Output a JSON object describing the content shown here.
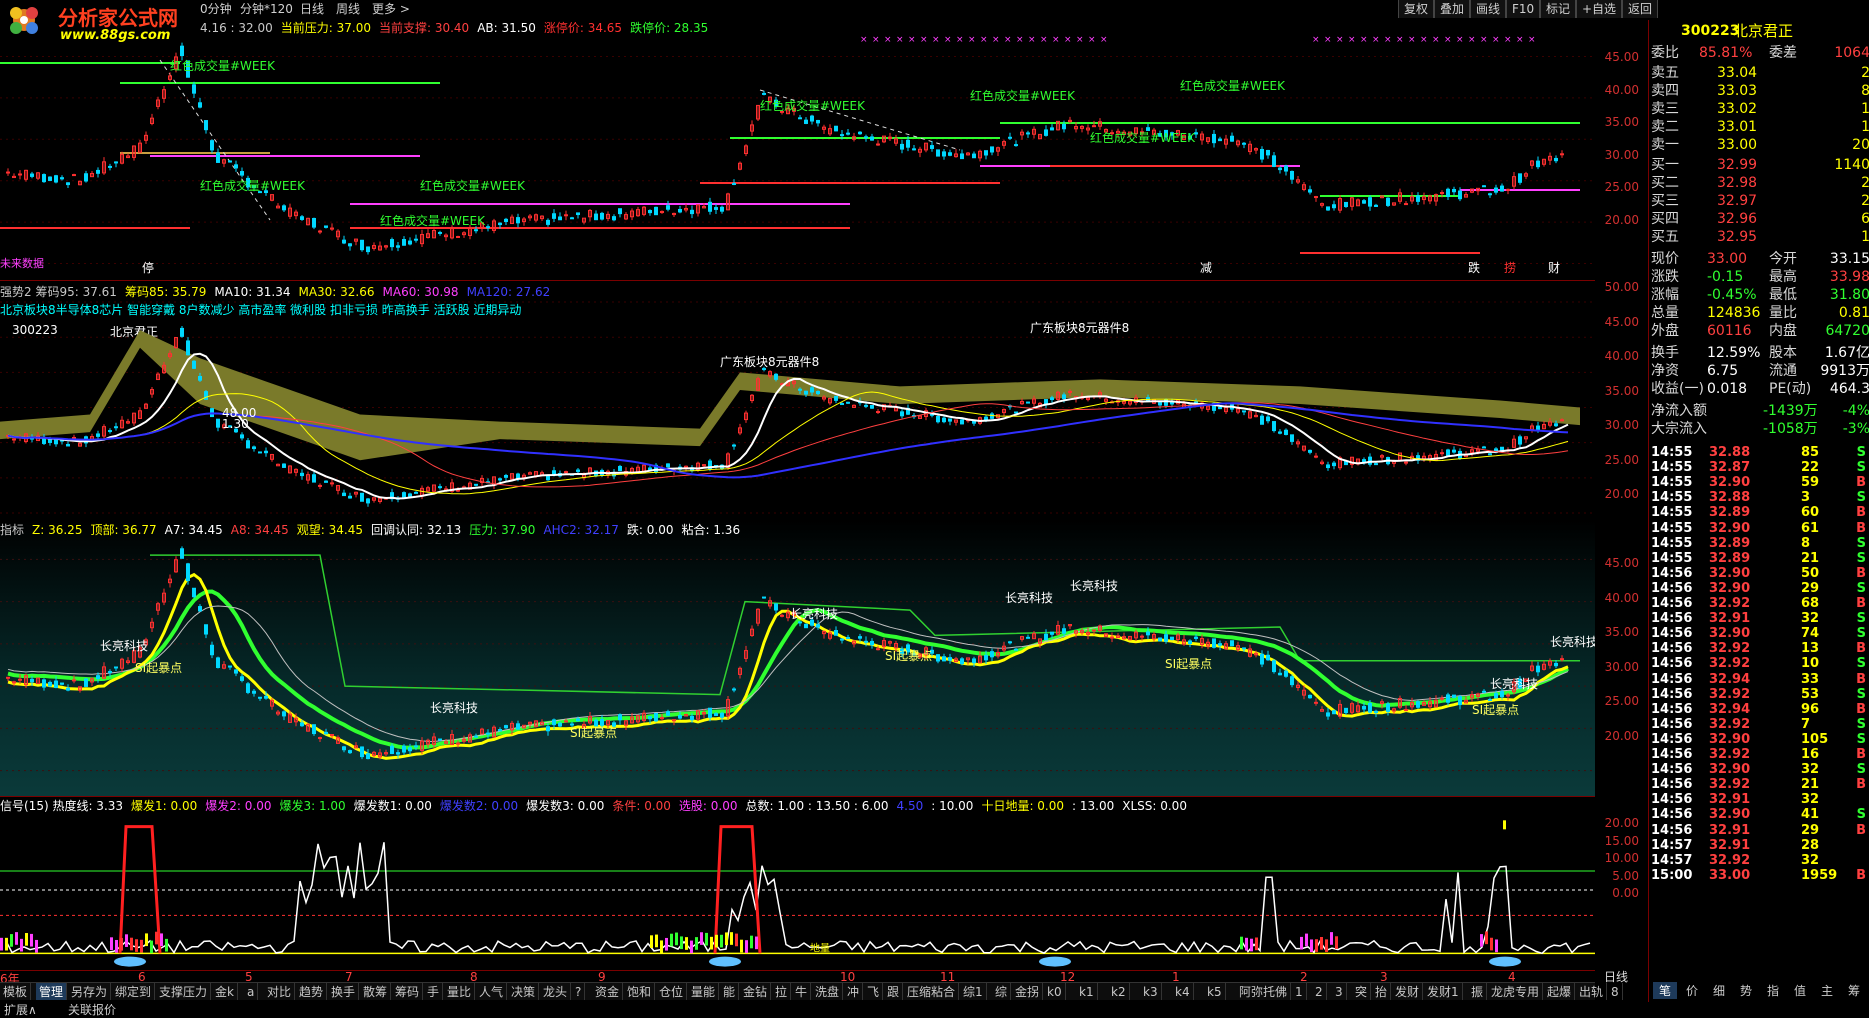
{
  "logo": {
    "title": "分析家公式网",
    "url": "www.88gs.com"
  },
  "topbar": {
    "left_items": [
      "0分钟",
      "分钟*120",
      "日线",
      "周线",
      "更多 >"
    ],
    "right_items": [
      "复权",
      "叠加",
      "画线",
      "F10",
      "标记",
      "+自选",
      "返回"
    ]
  },
  "stock": {
    "code": "300223",
    "name": "北京君正"
  },
  "panel1": {
    "header": [
      {
        "text": "4.16 : 32.00",
        "color": "#c8c8c8"
      },
      {
        "text": "当前压力: 37.00",
        "color": "#ffff00"
      },
      {
        "text": "当前支撑: 30.40",
        "color": "#ff4040"
      },
      {
        "text": "AB: 31.50",
        "color": "#ffffff"
      },
      {
        "text": "涨停价: 34.65",
        "color": "#ff3030"
      },
      {
        "text": "跌停价: 28.35",
        "color": "#30ff30"
      }
    ],
    "ticks": [
      "45.00",
      "40.00",
      "35.00",
      "30.00",
      "25.00",
      "20.00"
    ],
    "labels": [
      "红色成交量#WEEK",
      "红色成交量#WEEK",
      "红色成交量#WEEK",
      "红色成交量#WEEK",
      "红色成交量#WEEK",
      "红色成交量#WEEK",
      "红色成交量#WEEK",
      "红色成交量#WEEK"
    ],
    "events": [
      "停",
      "减",
      "跌",
      "捞",
      "财"
    ],
    "side_note": "未来数据"
  },
  "panel2": {
    "header1": [
      {
        "text": "强势2 筹码95: 37.61",
        "color": "#c8c8c8"
      },
      {
        "text": "筹码85: 35.79",
        "color": "#ffff00"
      },
      {
        "text": "MA10: 31.34",
        "color": "#ffffff"
      },
      {
        "text": "MA30: 32.66",
        "color": "#ffff00"
      },
      {
        "text": "MA60: 30.98",
        "color": "#ff40ff"
      },
      {
        "text": "MA120: 27.62",
        "color": "#4040ff"
      }
    ],
    "header2": "北京板块8半导体8芯片 智能穿戴 8户数减少 高市盈率 微利股 扣非亏损 昨高换手 活跃股 近期异动",
    "code_label": "300223",
    "name_label": "北京君正",
    "annotations": [
      "48.00",
      "1.30",
      "广东板块8元器件8",
      "广东板块8元器件8"
    ],
    "ticks": [
      "50.00",
      "45.00",
      "40.00",
      "35.00",
      "30.00",
      "25.00",
      "20.00"
    ]
  },
  "panel3": {
    "header": [
      {
        "text": "指标",
        "color": "#c8c8c8"
      },
      {
        "text": "Z: 36.25",
        "color": "#ffff00"
      },
      {
        "text": "顶部: 36.77",
        "color": "#ffff00"
      },
      {
        "text": "A7: 34.45",
        "color": "#ffffff"
      },
      {
        "text": "A8: 34.45",
        "color": "#ff4040"
      },
      {
        "text": "观望: 34.45",
        "color": "#ffff00"
      },
      {
        "text": "回调认同: 32.13",
        "color": "#ffffff"
      },
      {
        "text": "压力: 37.90",
        "color": "#30ff30"
      },
      {
        "text": "AHC2: 32.17",
        "color": "#4040ff"
      },
      {
        "text": "跌: 0.00",
        "color": "#ffffff"
      },
      {
        "text": "粘合: 1.36",
        "color": "#ffffff"
      }
    ],
    "labels": [
      "长亮科技",
      "SI起暴点",
      "长亮科技",
      "SI起暴点",
      "长亮科技",
      "SI起暴点",
      "长亮科技",
      "长亮科技",
      "SI起暴点",
      "长亮科技",
      "SI起暴点",
      "长亮科技"
    ],
    "ticks": [
      "45.00",
      "40.00",
      "35.00",
      "30.00",
      "25.00",
      "20.00"
    ]
  },
  "panel4": {
    "header": [
      {
        "text": "信号(15) 热度线: 3.33",
        "color": "#ffffff"
      },
      {
        "text": "爆发1: 0.00",
        "color": "#ffff00"
      },
      {
        "text": "爆发2: 0.00",
        "color": "#ff40ff"
      },
      {
        "text": "爆发3: 1.00",
        "color": "#30ff30"
      },
      {
        "text": "爆发数1: 0.00",
        "color": "#ffffff"
      },
      {
        "text": "爆发数2: 0.00",
        "color": "#4040ff"
      },
      {
        "text": "爆发数3: 0.00",
        "color": "#ffffff"
      },
      {
        "text": "条件: 0.00",
        "color": "#ff4040"
      },
      {
        "text": "选股: 0.00",
        "color": "#ff40ff"
      },
      {
        "text": "总数: 1.00 : 13.50 : 6.00",
        "color": "#ffffff"
      },
      {
        "text": "4.50",
        "color": "#4040ff"
      },
      {
        "text": ": 10.00",
        "color": "#ffffff"
      },
      {
        "text": "十日地量: 0.00",
        "color": "#ffff00"
      },
      {
        "text": ": 13.00",
        "color": "#ffffff"
      },
      {
        "text": "XLSS: 0.00",
        "color": "#ffffff"
      }
    ],
    "ticks": [
      "20.00",
      "15.00",
      "10.00",
      "5.00",
      "0.00"
    ],
    "marker_label": "地量"
  },
  "date_axis": [
    "6年",
    "6",
    "5",
    "7",
    "8",
    "9",
    "10",
    "11",
    "12",
    "1",
    "2",
    "3",
    "4"
  ],
  "date_axis_right": "日线",
  "bottom_tabs": [
    "管理",
    "另存为",
    "绑定到",
    "支撑压力",
    "金k",
    "a",
    "对比",
    "趋势",
    "换手",
    "散筹",
    "筹码",
    "手",
    "量比",
    "人气",
    "决策",
    "龙头",
    "?",
    "资金",
    "饱和",
    "仓位",
    "量能",
    "能",
    "金钻",
    "拉",
    "牛",
    "洗盘",
    "冲",
    "飞",
    "跟",
    "压缩粘合",
    "综1",
    "综",
    "金拐",
    "k0",
    "k1",
    "k2",
    "k3",
    "k4",
    "k5",
    "阿弥托佛",
    "1",
    "2",
    "3",
    "突",
    "抬",
    "发财",
    "发财1",
    "振",
    "龙虎专用",
    "起爆",
    "出轨",
    "8"
  ],
  "bottom_tab_first": "模板",
  "status_left": [
    "扩展∧",
    "关联报价"
  ],
  "quote": {
    "header_code": "300223",
    "header_name": "北京君正",
    "weibi_label": "委比",
    "weibi_value": "85.81%",
    "weicha_label": "委差",
    "weicha_value": "1064",
    "asks": [
      {
        "label": "卖五",
        "price": "33.04",
        "vol": "2"
      },
      {
        "label": "卖四",
        "price": "33.03",
        "vol": "8"
      },
      {
        "label": "卖三",
        "price": "33.02",
        "vol": "1"
      },
      {
        "label": "卖二",
        "price": "33.01",
        "vol": "1"
      },
      {
        "label": "卖一",
        "price": "33.00",
        "vol": "20"
      }
    ],
    "bids": [
      {
        "label": "买一",
        "price": "32.99",
        "vol": "1140"
      },
      {
        "label": "买二",
        "price": "32.98",
        "vol": "2"
      },
      {
        "label": "买三",
        "price": "32.97",
        "vol": "2"
      },
      {
        "label": "买四",
        "price": "32.96",
        "vol": "6"
      },
      {
        "label": "买五",
        "price": "32.95",
        "vol": "1"
      }
    ],
    "stats": [
      {
        "l1": "现价",
        "v1": "33.00",
        "c1": "#ff4040",
        "l2": "今开",
        "v2": "33.15",
        "c2": "#ffffff"
      },
      {
        "l1": "涨跌",
        "v1": "-0.15",
        "c1": "#30ff30",
        "l2": "最高",
        "v2": "33.98",
        "c2": "#ff4040"
      },
      {
        "l1": "涨幅",
        "v1": "-0.45%",
        "c1": "#30ff30",
        "l2": "最低",
        "v2": "31.80",
        "c2": "#30ff30"
      },
      {
        "l1": "总量",
        "v1": "124836",
        "c1": "#ffff00",
        "l2": "量比",
        "v2": "0.81",
        "c2": "#ffff00"
      },
      {
        "l1": "外盘",
        "v1": "60116",
        "c1": "#ff4040",
        "l2": "内盘",
        "v2": "64720",
        "c2": "#30ff30"
      }
    ],
    "stats2": [
      {
        "l1": "换手",
        "v1": "12.59%",
        "c1": "#ffffff",
        "l2": "股本",
        "v2": "1.67亿",
        "c2": "#ffffff"
      },
      {
        "l1": "净资",
        "v1": "6.75",
        "c1": "#ffffff",
        "l2": "流通",
        "v2": "9913万",
        "c2": "#ffffff"
      },
      {
        "l1": "收益(一)",
        "v1": "0.018",
        "c1": "#ffffff",
        "l2": "PE(动)",
        "v2": "464.3",
        "c2": "#ffffff"
      }
    ],
    "flow": [
      {
        "label": "净流入额",
        "v1": "-1439万",
        "v2": "-4%"
      },
      {
        "label": "大宗流入",
        "v1": "-1058万",
        "v2": "-3%"
      }
    ],
    "ticks": [
      {
        "t": "14:55",
        "p": "32.88",
        "v": "85",
        "d": "S"
      },
      {
        "t": "14:55",
        "p": "32.87",
        "v": "22",
        "d": "S"
      },
      {
        "t": "14:55",
        "p": "32.90",
        "v": "59",
        "d": "B"
      },
      {
        "t": "14:55",
        "p": "32.88",
        "v": "3",
        "d": "S"
      },
      {
        "t": "14:55",
        "p": "32.89",
        "v": "60",
        "d": "B"
      },
      {
        "t": "14:55",
        "p": "32.90",
        "v": "61",
        "d": "B"
      },
      {
        "t": "14:55",
        "p": "32.89",
        "v": "8",
        "d": "S"
      },
      {
        "t": "14:55",
        "p": "32.89",
        "v": "21",
        "d": "S"
      },
      {
        "t": "14:56",
        "p": "32.90",
        "v": "50",
        "d": "B"
      },
      {
        "t": "14:56",
        "p": "32.90",
        "v": "29",
        "d": "S"
      },
      {
        "t": "14:56",
        "p": "32.92",
        "v": "68",
        "d": "B"
      },
      {
        "t": "14:56",
        "p": "32.91",
        "v": "32",
        "d": "S"
      },
      {
        "t": "14:56",
        "p": "32.90",
        "v": "74",
        "d": "S"
      },
      {
        "t": "14:56",
        "p": "32.92",
        "v": "13",
        "d": "B"
      },
      {
        "t": "14:56",
        "p": "32.92",
        "v": "10",
        "d": "S"
      },
      {
        "t": "14:56",
        "p": "32.94",
        "v": "33",
        "d": "B"
      },
      {
        "t": "14:56",
        "p": "32.92",
        "v": "53",
        "d": "S"
      },
      {
        "t": "14:56",
        "p": "32.94",
        "v": "96",
        "d": "B"
      },
      {
        "t": "14:56",
        "p": "32.92",
        "v": "7",
        "d": "S"
      },
      {
        "t": "14:56",
        "p": "32.90",
        "v": "105",
        "d": "S"
      },
      {
        "t": "14:56",
        "p": "32.92",
        "v": "16",
        "d": "B"
      },
      {
        "t": "14:56",
        "p": "32.90",
        "v": "32",
        "d": "S"
      },
      {
        "t": "14:56",
        "p": "32.92",
        "v": "21",
        "d": "B"
      },
      {
        "t": "14:56",
        "p": "32.91",
        "v": "32",
        "d": ""
      },
      {
        "t": "14:56",
        "p": "32.90",
        "v": "41",
        "d": "S"
      },
      {
        "t": "14:56",
        "p": "32.91",
        "v": "29",
        "d": "B"
      },
      {
        "t": "14:57",
        "p": "32.91",
        "v": "28",
        "d": ""
      },
      {
        "t": "14:57",
        "p": "32.92",
        "v": "32",
        "d": ""
      },
      {
        "t": "15:00",
        "p": "33.00",
        "v": "1959",
        "d": "B"
      }
    ],
    "bottom_tabs": [
      "笔",
      "价",
      "细",
      "势",
      "指",
      "值",
      "主",
      "筹"
    ]
  },
  "colors": {
    "up": "#ff3030",
    "down": "#00d8ff",
    "green": "#30ff30",
    "yellow": "#ffff00",
    "magenta": "#ff40ff",
    "grid": "#7a0000"
  }
}
